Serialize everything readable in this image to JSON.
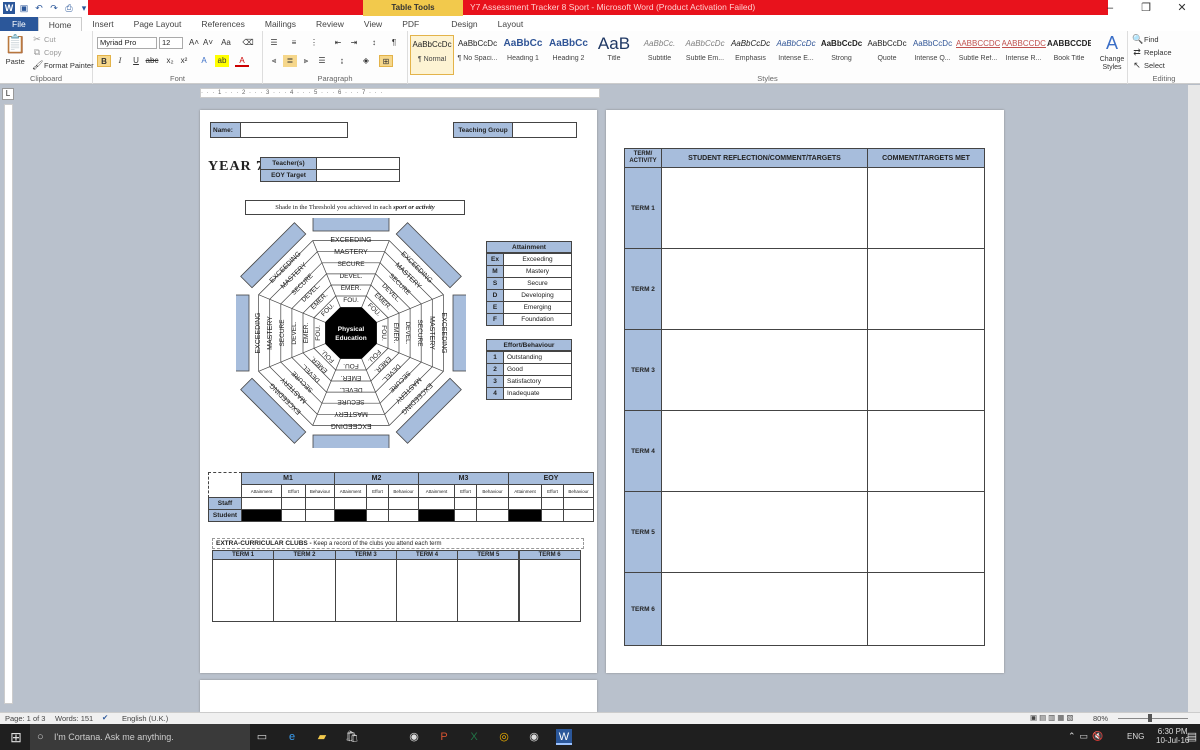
{
  "window": {
    "title": "Y7 Assessment Tracker 8 Sport - Microsoft Word (Product Activation Failed)",
    "contextual_tab": "Table Tools",
    "controls": [
      "–",
      "❐",
      "✕"
    ]
  },
  "tabs": [
    "File",
    "Home",
    "Insert",
    "Page Layout",
    "References",
    "Mailings",
    "Review",
    "View",
    "PDF",
    "Design",
    "Layout"
  ],
  "ribbon": {
    "clipboard": {
      "paste": "Paste",
      "cut": "Cut",
      "copy": "Copy",
      "format_painter": "Format Painter",
      "label": "Clipboard"
    },
    "font": {
      "name": "Myriad Pro",
      "size": "12",
      "label": "Font"
    },
    "paragraph": {
      "label": "Paragraph"
    },
    "styles": {
      "label": "Styles",
      "items": [
        {
          "preview": "AaBbCcDc",
          "name": "¶ Normal"
        },
        {
          "preview": "AaBbCcDc",
          "name": "¶ No Spaci..."
        },
        {
          "preview": "AaBbCc",
          "name": "Heading 1"
        },
        {
          "preview": "AaBbCc",
          "name": "Heading 2"
        },
        {
          "preview": "AaB",
          "name": "Title"
        },
        {
          "preview": "AaBbCc.",
          "name": "Subtitle"
        },
        {
          "preview": "AaBbCcDc",
          "name": "Subtle Em..."
        },
        {
          "preview": "AaBbCcDc",
          "name": "Emphasis"
        },
        {
          "preview": "AaBbCcDc",
          "name": "Intense E..."
        },
        {
          "preview": "AaBbCcDc",
          "name": "Strong"
        },
        {
          "preview": "AaBbCcDc",
          "name": "Quote"
        },
        {
          "preview": "AaBbCcDc",
          "name": "Intense Q..."
        },
        {
          "preview": "AABBCCDC",
          "name": "Subtle Ref..."
        },
        {
          "preview": "AABBCCDC",
          "name": "Intense R..."
        },
        {
          "preview": "AABBCCDE",
          "name": "Book Title"
        }
      ],
      "change_styles": "Change Styles"
    },
    "editing": {
      "find": "Find",
      "replace": "Replace",
      "select": "Select",
      "label": "Editing"
    }
  },
  "page1": {
    "name_label": "Name:",
    "teaching_group_label": "Teaching Group",
    "year": "YEAR 7",
    "teacher_label": "Teacher(s)",
    "eoy_label": "EOY Target",
    "instruction_prefix": "Shade in the Threshold you achieved in each ",
    "instruction_emph": "sport or activity",
    "wheel_center": [
      "Physical",
      "Education"
    ],
    "wheel_levels": [
      "EXCEEDING",
      "MASTERY",
      "SECURE",
      "DEVEL.",
      "EMER.",
      "FOU."
    ],
    "attainment": {
      "title": "Attainment",
      "rows": [
        [
          "Ex",
          "Exceeding"
        ],
        [
          "M",
          "Mastery"
        ],
        [
          "S",
          "Secure"
        ],
        [
          "D",
          "Developing"
        ],
        [
          "E",
          "Emerging"
        ],
        [
          "F",
          "Foundation"
        ]
      ]
    },
    "effort": {
      "title": "Effort/Behaviour",
      "rows": [
        [
          "1",
          "Outstanding"
        ],
        [
          "2",
          "Good"
        ],
        [
          "3",
          "Satisfactory"
        ],
        [
          "4",
          "Inadequate"
        ]
      ]
    },
    "grid": {
      "periods": [
        "M1",
        "M2",
        "M3",
        "EOY"
      ],
      "subcols": [
        "Attainment",
        "Effort",
        "Behaviour"
      ],
      "rows": [
        "Staff",
        "Student"
      ]
    },
    "clubs": {
      "title": "EXTRA-CURRICULAR CLUBS -",
      "subtitle": "Keep a record of the clubs you attend each term",
      "terms": [
        "TERM 1",
        "TERM 2",
        "TERM 3",
        "TERM 4",
        "TERM 5",
        "TERM 6"
      ]
    }
  },
  "page2": {
    "col1": "TERM/ ACTIVITY",
    "col2": "STUDENT REFLECTION/COMMENT/TARGETS",
    "col3": "COMMENT/TARGETS MET",
    "terms": [
      "TERM 1",
      "TERM 2",
      "TERM 3",
      "TERM 4",
      "TERM 5",
      "TERM 6"
    ]
  },
  "status": {
    "page": "Page: 1 of 3",
    "words": "Words: 151",
    "lang": "English (U.K.)",
    "zoom": "80%"
  },
  "taskbar": {
    "search": "I'm Cortana. Ask me anything.",
    "lang": "ENG",
    "time": "6:30 PM",
    "date": "10-Jul-16"
  }
}
